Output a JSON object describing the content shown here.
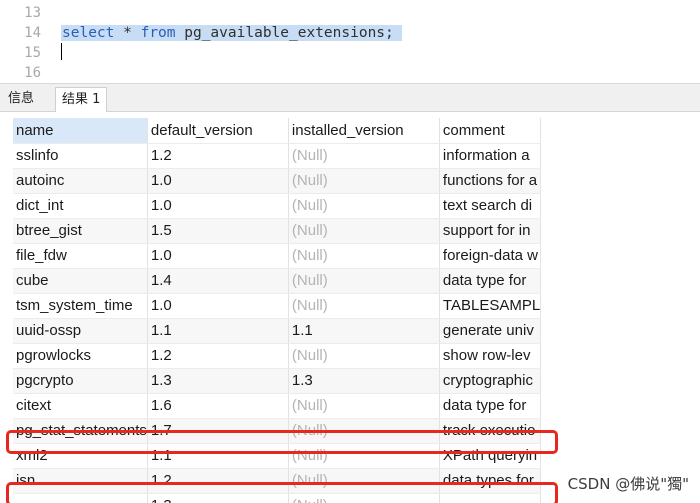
{
  "editor": {
    "lines": [
      {
        "no": "13",
        "text": ""
      },
      {
        "no": "14",
        "keyword1": "select",
        "mid": " * ",
        "keyword2": "from",
        "rest": " pg_available_extensions;"
      },
      {
        "no": "15",
        "text": ""
      },
      {
        "no": "16",
        "text": ""
      }
    ]
  },
  "tabs": [
    {
      "label": "信息"
    },
    {
      "label": "结果 1"
    }
  ],
  "table": {
    "columns": [
      "name",
      "default_version",
      "installed_version",
      "comment"
    ],
    "rows": [
      [
        "sslinfo",
        "1.2",
        "(Null)",
        "information a"
      ],
      [
        "autoinc",
        "1.0",
        "(Null)",
        "functions for a"
      ],
      [
        "dict_int",
        "1.0",
        "(Null)",
        "text search di"
      ],
      [
        "btree_gist",
        "1.5",
        "(Null)",
        "support for in"
      ],
      [
        "file_fdw",
        "1.0",
        "(Null)",
        "foreign-data w"
      ],
      [
        "cube",
        "1.4",
        "(Null)",
        "data type for"
      ],
      [
        "tsm_system_time",
        "1.0",
        "(Null)",
        "TABLESAMPL"
      ],
      [
        "uuid-ossp",
        "1.1",
        "1.1",
        "generate univ"
      ],
      [
        "pgrowlocks",
        "1.2",
        "(Null)",
        "show row-lev"
      ],
      [
        "pgcrypto",
        "1.3",
        "1.3",
        "cryptographic"
      ],
      [
        "citext",
        "1.6",
        "(Null)",
        "data type for"
      ],
      [
        "pg_stat_statements",
        "1.7",
        "(Null)",
        "track executio"
      ],
      [
        "xml2",
        "1.1",
        "(Null)",
        "XPath queryin"
      ],
      [
        "isn",
        "1.2",
        "(Null)",
        "data types for"
      ],
      [
        "",
        "1.3",
        "(Null)",
        ""
      ]
    ]
  },
  "watermark": "CSDN @佛说\"獨\"",
  "colors": {
    "highlight_box": "#e8281e",
    "selection": "#c7dcf5",
    "keyword": "#2a5db5"
  }
}
